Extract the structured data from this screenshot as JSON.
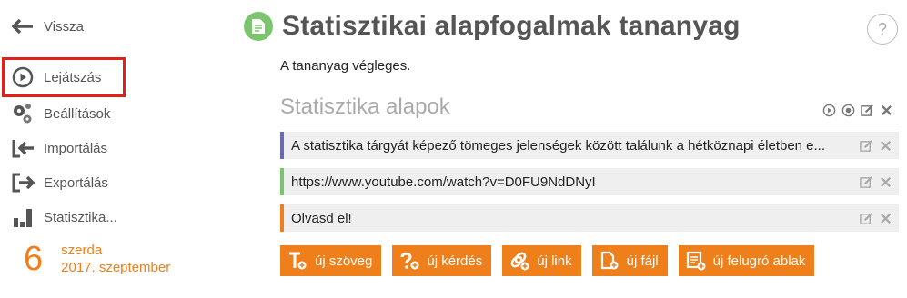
{
  "sidebar": {
    "back_label": "Vissza",
    "items": [
      {
        "label": "Lejátszás"
      },
      {
        "label": "Beállítások"
      },
      {
        "label": "Importálás"
      },
      {
        "label": "Exportálás"
      },
      {
        "label": "Statisztika..."
      }
    ],
    "date": {
      "day": "6",
      "weekday": "szerda",
      "date": "2017. szeptember"
    }
  },
  "header": {
    "title": "Statisztikai alapfogalmak tananyag",
    "help": "?",
    "status": "A tananyag végleges."
  },
  "section": {
    "title": "Statisztika alapok",
    "rows": [
      {
        "text": "A statisztika tárgyát képező tömeges jelenségek között találunk a hétköznapi életben e...",
        "color": "#6b6bb3"
      },
      {
        "text": "https://www.youtube.com/watch?v=D0FU9NdDNyI",
        "color": "#7dc470"
      },
      {
        "text": "Olvasd el!",
        "color": "#ef7f1a"
      }
    ]
  },
  "actions": [
    {
      "label": "új szöveg"
    },
    {
      "label": "új kérdés"
    },
    {
      "label": "új link"
    },
    {
      "label": "új fájl"
    },
    {
      "label": "új felugró ablak"
    }
  ],
  "colors": {
    "accent": "#ef7f1a",
    "active_outline": "#e0201b"
  }
}
